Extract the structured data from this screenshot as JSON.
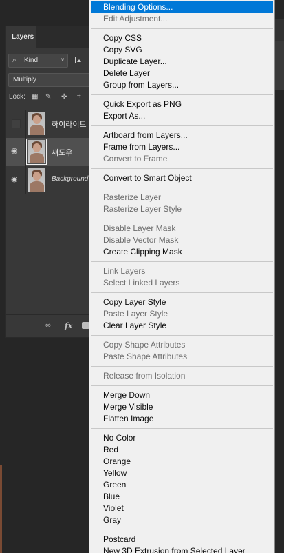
{
  "layers_panel": {
    "tab_label": "Layers",
    "filter_kind": "Kind",
    "blend_mode": "Multiply",
    "lock_label": "Lock:",
    "layers": [
      {
        "name": "하이라이트",
        "visible": false,
        "selected": false,
        "italic": false
      },
      {
        "name": "섀도우",
        "visible": true,
        "selected": true,
        "italic": false
      },
      {
        "name": "Background",
        "visible": true,
        "selected": false,
        "italic": true
      }
    ],
    "footer_icons": [
      "link-icon",
      "fx-icon",
      "mask-icon"
    ]
  },
  "context_menu": {
    "groups": [
      [
        {
          "label": "Blending Options...",
          "disabled": false,
          "highlighted": true
        },
        {
          "label": "Edit Adjustment...",
          "disabled": true,
          "highlighted": false
        }
      ],
      [
        {
          "label": "Copy CSS",
          "disabled": false
        },
        {
          "label": "Copy SVG",
          "disabled": false
        },
        {
          "label": "Duplicate Layer...",
          "disabled": false
        },
        {
          "label": "Delete Layer",
          "disabled": false
        },
        {
          "label": "Group from Layers...",
          "disabled": false
        }
      ],
      [
        {
          "label": "Quick Export as PNG",
          "disabled": false
        },
        {
          "label": "Export As...",
          "disabled": false
        }
      ],
      [
        {
          "label": "Artboard from Layers...",
          "disabled": false
        },
        {
          "label": "Frame from Layers...",
          "disabled": false
        },
        {
          "label": "Convert to Frame",
          "disabled": true
        }
      ],
      [
        {
          "label": "Convert to Smart Object",
          "disabled": false
        }
      ],
      [
        {
          "label": "Rasterize Layer",
          "disabled": true
        },
        {
          "label": "Rasterize Layer Style",
          "disabled": true
        }
      ],
      [
        {
          "label": "Disable Layer Mask",
          "disabled": true
        },
        {
          "label": "Disable Vector Mask",
          "disabled": true
        },
        {
          "label": "Create Clipping Mask",
          "disabled": false
        }
      ],
      [
        {
          "label": "Link Layers",
          "disabled": true
        },
        {
          "label": "Select Linked Layers",
          "disabled": true
        }
      ],
      [
        {
          "label": "Copy Layer Style",
          "disabled": false
        },
        {
          "label": "Paste Layer Style",
          "disabled": true
        },
        {
          "label": "Clear Layer Style",
          "disabled": false
        }
      ],
      [
        {
          "label": "Copy Shape Attributes",
          "disabled": true
        },
        {
          "label": "Paste Shape Attributes",
          "disabled": true
        }
      ],
      [
        {
          "label": "Release from Isolation",
          "disabled": true
        }
      ],
      [
        {
          "label": "Merge Down",
          "disabled": false
        },
        {
          "label": "Merge Visible",
          "disabled": false
        },
        {
          "label": "Flatten Image",
          "disabled": false
        }
      ],
      [
        {
          "label": "No Color",
          "disabled": false
        },
        {
          "label": "Red",
          "disabled": false
        },
        {
          "label": "Orange",
          "disabled": false
        },
        {
          "label": "Yellow",
          "disabled": false
        },
        {
          "label": "Green",
          "disabled": false
        },
        {
          "label": "Blue",
          "disabled": false
        },
        {
          "label": "Violet",
          "disabled": false
        },
        {
          "label": "Gray",
          "disabled": false
        }
      ],
      [
        {
          "label": "Postcard",
          "disabled": false
        },
        {
          "label": "New 3D Extrusion from Selected Layer",
          "disabled": false
        }
      ]
    ]
  },
  "colors": {
    "highlight": "#0078d7",
    "menu_bg": "#f0f0f0",
    "panel_bg": "#383838",
    "workspace_bg": "#262626"
  }
}
